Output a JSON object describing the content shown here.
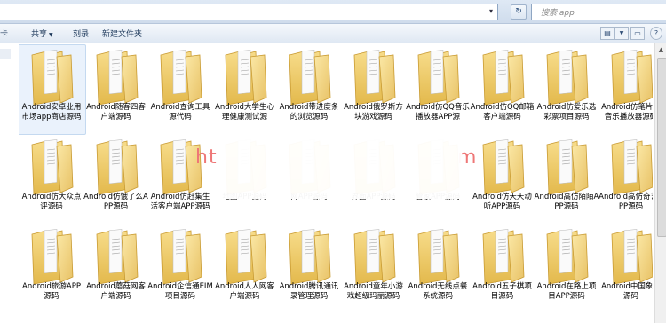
{
  "address": {
    "dropdown_glyph": "▾"
  },
  "nav": {
    "refresh": "↻"
  },
  "search": {
    "placeholder": "搜索 app"
  },
  "toolbar": {
    "items": [
      {
        "label": "卡"
      },
      {
        "label": "共享",
        "has_dropdown": true
      },
      {
        "label": "刻录"
      },
      {
        "label": "新建文件夹"
      }
    ],
    "view_glyph": "▤",
    "help_glyph": "?"
  },
  "watermark": {
    "left": "ht",
    "right": "m"
  },
  "folders": [
    "Android安卓业用市场app商店源码",
    "Android随客四客户端源码",
    "Android查询工具源代码",
    "Android大学生心理健康测试源",
    "Android带进度条的浏览源码",
    "Android俄罗斯方块游戏源码",
    "Android仿QQ音乐播放器APP源",
    "Android仿QQ邮箱客户端源码",
    "Android仿爱乐选彩票项目源码",
    "Android仿笔片机音乐播放器源码",
    "Android仿大众点评源码",
    "Android仿饿了么APP源码",
    "Android仿赶集生活客户端APP源码",
    "地图APP源码",
    "网APP源码",
    "界面APP源码",
    "管家APP源码",
    "Android仿天天动听APP源码",
    "Android高仿陌陌APP源码",
    "Android高仿奇艺APP源码",
    "Android旅游APP源码",
    "Android蘑菇网客户端源码",
    "Android企信通EIM项目源码",
    "Android人人网客户端源码",
    "Android腾讯通讯录管理源码",
    "Android童年小游戏超级玛丽源码",
    "Android无线点餐系统源码",
    "Android五子棋项目源码",
    "Android在路上项目APP源码",
    "Android中国象棋源码"
  ]
}
